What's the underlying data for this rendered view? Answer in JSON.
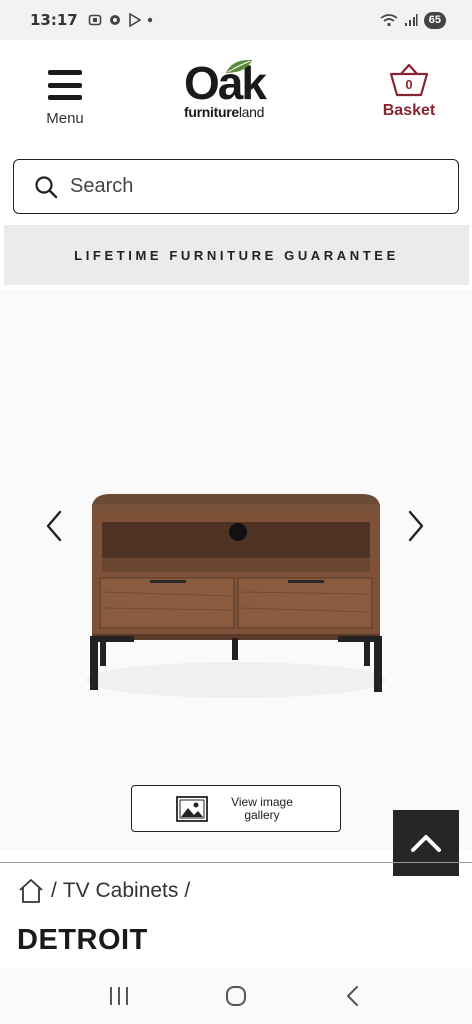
{
  "status_bar": {
    "time": "13:17",
    "battery": "65"
  },
  "header": {
    "menu_label": "Menu",
    "logo_main": "Oak",
    "logo_sub_bold": "furniture",
    "logo_sub_light": "land",
    "basket_label": "Basket",
    "basket_count": "0"
  },
  "search": {
    "placeholder": "Search"
  },
  "banner": {
    "text": "LIFETIME FURNITURE GUARANTEE"
  },
  "gallery": {
    "view_gallery_label": "View image gallery"
  },
  "breadcrumb": {
    "items": [
      "TV Cabinets"
    ]
  },
  "product": {
    "title": "DETROIT"
  },
  "colors": {
    "brand_red": "#8a2432",
    "dark": "#262626",
    "banner_bg": "#ebebeb"
  }
}
